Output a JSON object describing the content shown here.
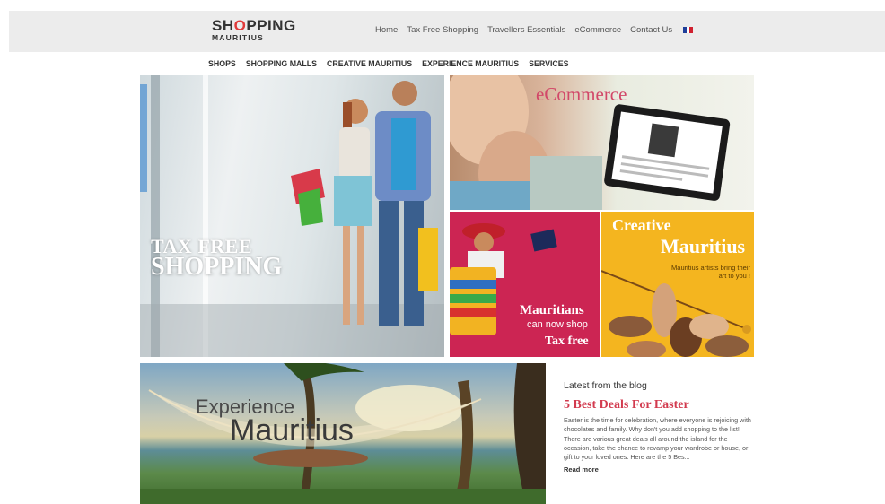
{
  "header": {
    "logo_main_pre": "SH",
    "logo_main_o": "O",
    "logo_main_post": "PPING",
    "logo_sub": "MAURITIUS",
    "nav": [
      "Home",
      "Tax Free Shopping",
      "Travellers Essentials",
      "eCommerce",
      "Contact Us"
    ],
    "language_flag": "french-flag-icon"
  },
  "categories": [
    "SHOPS",
    "SHOPPING MALLS",
    "CREATIVE MAURITIUS",
    "EXPERIENCE MAURITIUS",
    "SERVICES"
  ],
  "tiles": {
    "tax_free": {
      "line1": "TAX FREE",
      "line2": "SHOPPING"
    },
    "ecommerce": {
      "label": "eCommerce"
    },
    "mauritians": {
      "line1": "Mauritians",
      "line2": "can now shop",
      "line3": "Tax free"
    },
    "creative": {
      "line1": "Creative",
      "line2": "Mauritius",
      "tagline": "Mauritius artists bring their art to you !"
    },
    "experience": {
      "line1": "Experience",
      "line2": "Mauritius"
    }
  },
  "blog": {
    "heading": "Latest from the blog",
    "title": "5 Best Deals For Easter",
    "excerpt": "Easter is the time for celebration, where everyone is rejoicing with chocolates and family. Why don't you add shopping to the list! There are various great deals all around the island for the occasion, take the chance to revamp your wardrobe or house, or gift to your loved ones. Here are the 5 Bes...",
    "read_more": "Read more"
  },
  "colors": {
    "accent": "#d23a4e",
    "header_bg": "#ececec",
    "mauritians_tile": "#cc2553",
    "creative_tile": "#f4b51f",
    "flag": [
      "#1f3f9a",
      "#ffffff",
      "#d0202f"
    ]
  }
}
